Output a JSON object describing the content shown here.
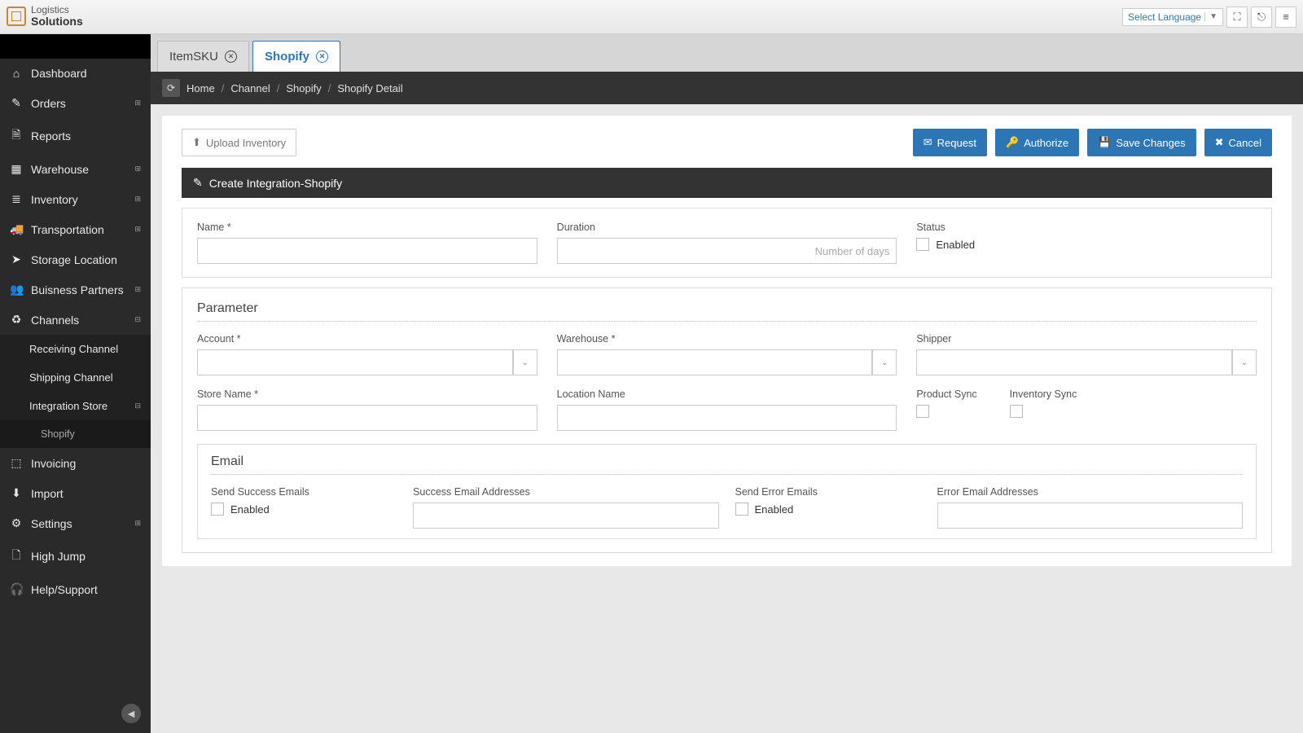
{
  "app": {
    "name1": "Logistics",
    "name2": "Solutions"
  },
  "topbar": {
    "language": "Select Language"
  },
  "sidebar": {
    "items": [
      {
        "label": "Dashboard",
        "icon": "home"
      },
      {
        "label": "Orders",
        "icon": "edit",
        "expand": true
      },
      {
        "label": "Reports",
        "icon": "file"
      },
      {
        "label": "Warehouse",
        "icon": "sitemap",
        "expand": true
      },
      {
        "label": "Inventory",
        "icon": "list",
        "expand": true
      },
      {
        "label": "Transportation",
        "icon": "truck",
        "expand": true
      },
      {
        "label": "Storage Location",
        "icon": "location"
      },
      {
        "label": "Buisness Partners",
        "icon": "users",
        "expand": true
      },
      {
        "label": "Channels",
        "icon": "recycle",
        "expand": true,
        "open": true
      },
      {
        "label": "Invoicing",
        "icon": "money"
      },
      {
        "label": "Import",
        "icon": "download"
      },
      {
        "label": "Settings",
        "icon": "gears",
        "expand": true
      },
      {
        "label": "High Jump",
        "icon": "doc"
      },
      {
        "label": "Help/Support",
        "icon": "headphones"
      }
    ],
    "channels_sub": [
      {
        "label": "Receiving Channel"
      },
      {
        "label": "Shipping Channel"
      },
      {
        "label": "Integration Store",
        "expand": true,
        "open": true
      }
    ],
    "integration_sub": [
      {
        "label": "Shopify"
      }
    ]
  },
  "tabs": [
    {
      "label": "ItemSKU",
      "active": false
    },
    {
      "label": "Shopify",
      "active": true
    }
  ],
  "breadcrumb": [
    "Home",
    "Channel",
    "Shopify",
    "Shopify Detail"
  ],
  "actions": {
    "upload": "Upload Inventory",
    "request": "Request",
    "authorize": "Authorize",
    "save": "Save Changes",
    "cancel": "Cancel"
  },
  "panel": {
    "title": "Create Integration-Shopify"
  },
  "form": {
    "name_label": "Name *",
    "duration_label": "Duration",
    "duration_placeholder": "Number of days",
    "status_label": "Status",
    "status_enabled": "Enabled",
    "param_title": "Parameter",
    "account_label": "Account *",
    "warehouse_label": "Warehouse *",
    "shipper_label": "Shipper",
    "store_label": "Store Name *",
    "location_label": "Location Name",
    "product_sync_label": "Product Sync",
    "inventory_sync_label": "Inventory Sync",
    "email_title": "Email",
    "send_success_label": "Send Success Emails",
    "success_addr_label": "Success Email Addresses",
    "send_error_label": "Send Error Emails",
    "error_addr_label": "Error Email Addresses",
    "enabled_text": "Enabled"
  }
}
